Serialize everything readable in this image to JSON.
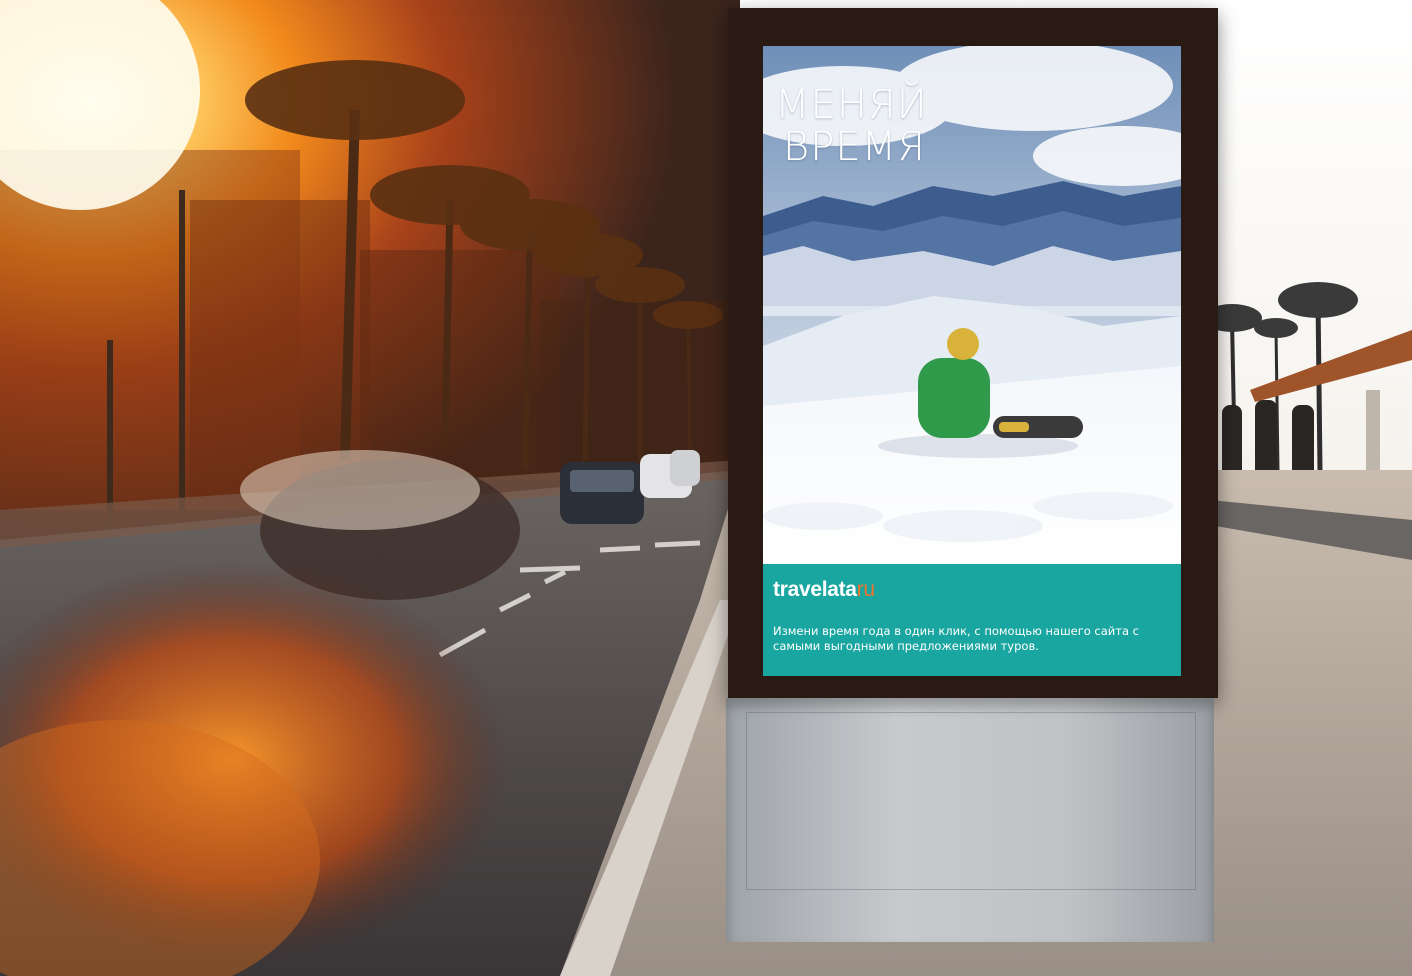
{
  "scene": {
    "description_labels": {
      "sun": "sun-glare",
      "street": "street-with-palms",
      "billboard": "city-billboard"
    }
  },
  "poster": {
    "headline_line1": "МЕНЯЙ",
    "headline_line2": "ВРЕМЯ",
    "brand_main": "travelata",
    "brand_accent": "ru",
    "tagline": "Измени время года в один клик, с помощью нашего сайта с самыми выгодными предложениями туров."
  },
  "colors": {
    "band": "#1aa6a0",
    "brand_accent": "#f0732a",
    "frame": "#2a1a14"
  }
}
